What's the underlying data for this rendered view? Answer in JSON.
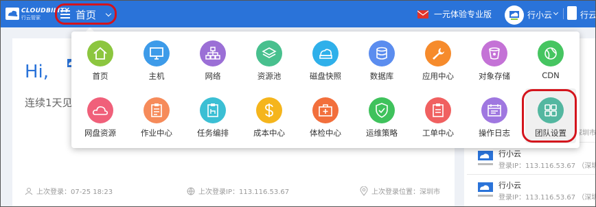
{
  "header": {
    "logo_text": "CLOUDBILITY",
    "logo_sub": "行云管家",
    "home_label": "首页",
    "promo_label": "一元体验专业版",
    "user_name": "行小云",
    "user2_name": "行云",
    "colors": {
      "bar": "#2a73d9",
      "highlight": "#d4141c"
    }
  },
  "main": {
    "greeting": "Hi,",
    "streak_text": "连续1天见",
    "last_login_time": "上次登录：07-25 18:23",
    "last_login_ip": "上次登录IP：113.116.53.67",
    "last_login_place": "上次登录位置：深圳市"
  },
  "logs": [
    {
      "name": "行小云",
      "ip": "登录IP：113.116.53.67 （深圳市"
    },
    {
      "name": "行小云",
      "ip": "登录IP：113.116.53.67 （深圳市"
    }
  ],
  "logs_partial": {
    "top_row_fragment": "深圳市"
  },
  "menu": {
    "items": [
      {
        "label": "首页",
        "icon": "home-icon",
        "color": "#8cc63f"
      },
      {
        "label": "主机",
        "icon": "monitor-icon",
        "color": "#3d9be9"
      },
      {
        "label": "网络",
        "icon": "network-icon",
        "color": "#9b6fd6"
      },
      {
        "label": "资源池",
        "icon": "layers-icon",
        "color": "#48c08e"
      },
      {
        "label": "磁盘快照",
        "icon": "disk-icon",
        "color": "#2fb0ea"
      },
      {
        "label": "数据库",
        "icon": "database-icon",
        "color": "#5b8def"
      },
      {
        "label": "应用中心",
        "icon": "wrench-icon",
        "color": "#f68b2c"
      },
      {
        "label": "对象存储",
        "icon": "bucket-icon",
        "color": "#c472d6"
      },
      {
        "label": "CDN",
        "icon": "globe-icon",
        "color": "#46c561"
      },
      {
        "label": "网盘资源",
        "icon": "cloud-icon",
        "color": "#f0607a"
      },
      {
        "label": "作业中心",
        "icon": "clipboard-icon",
        "color": "#f68b5a"
      },
      {
        "label": "任务编排",
        "icon": "task-flow-icon",
        "color": "#3bbfd4"
      },
      {
        "label": "成本中心",
        "icon": "dollar-icon",
        "color": "#f5b51c"
      },
      {
        "label": "体检中心",
        "icon": "medical-kit-icon",
        "color": "#f26f3c"
      },
      {
        "label": "运维策略",
        "icon": "shield-icon",
        "color": "#3fc25c"
      },
      {
        "label": "工单中心",
        "icon": "ticket-icon",
        "color": "#f06060"
      },
      {
        "label": "操作日志",
        "icon": "calendar-icon",
        "color": "#9f77e0"
      },
      {
        "label": "团队设置",
        "icon": "grid-icon",
        "color": "#53b7a0"
      }
    ]
  }
}
